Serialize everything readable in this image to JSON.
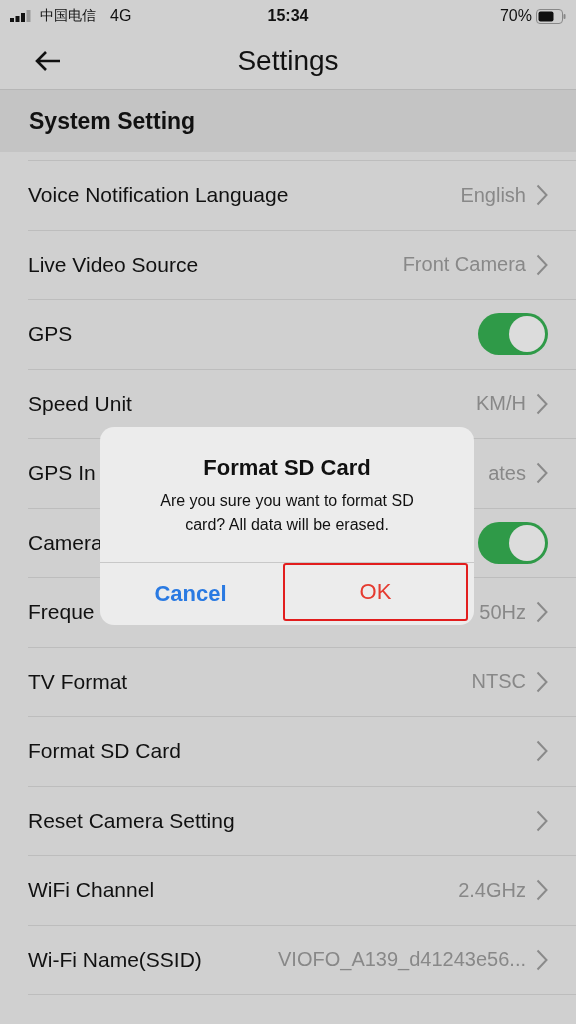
{
  "status_bar": {
    "carrier": "中国电信",
    "network": "4G",
    "time": "15:34",
    "battery": "70%"
  },
  "nav": {
    "title": "Settings"
  },
  "section": {
    "title": "System Setting"
  },
  "rows": [
    {
      "kind": "link",
      "label": "Voice Notification Language",
      "value": "English"
    },
    {
      "kind": "link",
      "label": "Live Video Source",
      "value": "Front Camera"
    },
    {
      "kind": "toggle",
      "label": "GPS",
      "on": true
    },
    {
      "kind": "link",
      "label": "Speed Unit",
      "value": "KM/H"
    },
    {
      "kind": "link",
      "label": "GPS In",
      "value": "ates"
    },
    {
      "kind": "toggle",
      "label": "Camera",
      "on": true
    },
    {
      "kind": "link",
      "label": "Freque",
      "value": "50Hz"
    },
    {
      "kind": "link",
      "label": "TV Format",
      "value": "NTSC"
    },
    {
      "kind": "link",
      "label": "Format SD Card"
    },
    {
      "kind": "link",
      "label": "Reset Camera Setting"
    },
    {
      "kind": "link",
      "label": "WiFi Channel",
      "value": "2.4GHz"
    },
    {
      "kind": "link",
      "label": "Wi-Fi Name(SSID)",
      "value": "VIOFO_A139_d41243e56..."
    }
  ],
  "dialog": {
    "title": "Format SD Card",
    "message": "Are you sure you want to format SD card? All data will be erased.",
    "buttons": [
      {
        "label": "Cancel",
        "kind": "cancel",
        "highlighted": false
      },
      {
        "label": "OK",
        "kind": "destructive",
        "highlighted": true
      }
    ]
  }
}
